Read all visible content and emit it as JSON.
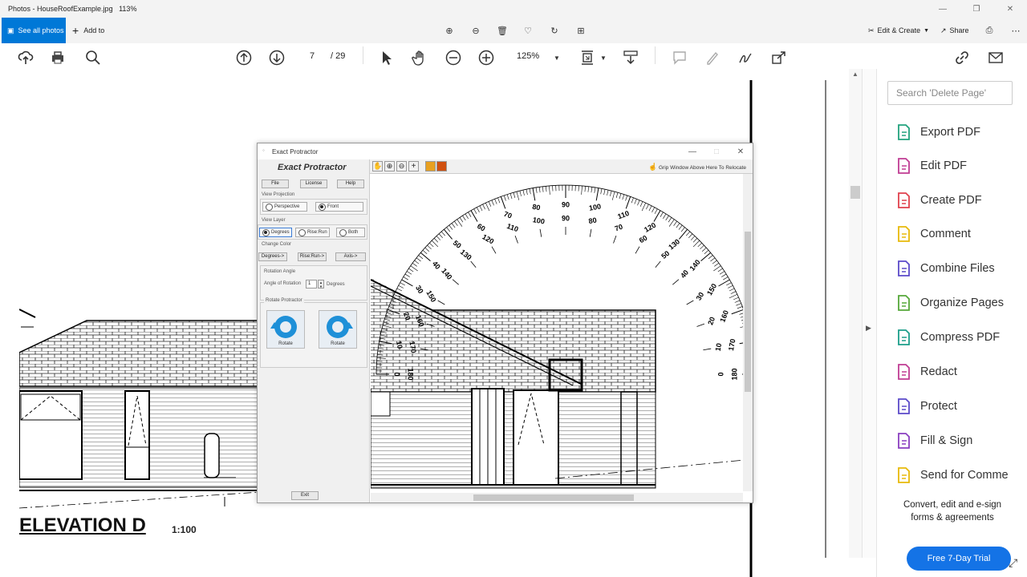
{
  "window": {
    "title": "Photos - HouseRoofExample.jpg",
    "zoom": "113%"
  },
  "photos_toolbar": {
    "see_all_label": "See all photos",
    "add_to_label": "Add to",
    "edit_create_label": "Edit & Create",
    "share_label": "Share"
  },
  "pdf_toolbar": {
    "page_current": "7",
    "page_total": "/  29",
    "zoom": "125%"
  },
  "tools_panel": {
    "search_placeholder": "Search 'Delete Page'",
    "items": [
      {
        "label": "Export PDF",
        "icon": "export-pdf-icon",
        "color": "#22a27d"
      },
      {
        "label": "Edit PDF",
        "icon": "edit-pdf-icon",
        "color": "#c03c93"
      },
      {
        "label": "Create PDF",
        "icon": "create-pdf-icon",
        "color": "#e0414d"
      },
      {
        "label": "Comment",
        "icon": "comment-icon",
        "color": "#e8b90a"
      },
      {
        "label": "Combine Files",
        "icon": "combine-files-icon",
        "color": "#5b4ac9"
      },
      {
        "label": "Organize Pages",
        "icon": "organize-pages-icon",
        "color": "#55a83a"
      },
      {
        "label": "Compress PDF",
        "icon": "compress-pdf-icon",
        "color": "#1c9e8a"
      },
      {
        "label": "Redact",
        "icon": "redact-icon",
        "color": "#c03c93"
      },
      {
        "label": "Protect",
        "icon": "protect-icon",
        "color": "#5b4ac9"
      },
      {
        "label": "Fill & Sign",
        "icon": "fill-sign-icon",
        "color": "#8a3fc0"
      },
      {
        "label": "Send for Comme",
        "icon": "send-comment-icon",
        "color": "#e8b90a"
      }
    ],
    "promo_line1": "Convert, edit and e-sign",
    "promo_line2": "forms & agreements",
    "trial_label": "Free 7-Day Trial"
  },
  "protractor_window": {
    "title": "Exact Protractor",
    "heading": "Exact Protractor",
    "menu": [
      "File",
      "License",
      "Help"
    ],
    "view_projection_label": "View Projection",
    "projection_options": [
      "Perspective",
      "Front"
    ],
    "projection_selected": "Front",
    "view_layer_label": "View Layer",
    "layer_options": [
      "Degrees",
      "Rise:Run",
      "Both"
    ],
    "layer_selected": "Degrees",
    "change_color_label": "Change Color",
    "color_buttons": [
      "Degrees->",
      "Rise:Run->",
      "Axis->"
    ],
    "rotation_angle_label": "Rotation Angle",
    "angle_field_label": "Angle of Rotation",
    "angle_value": "1",
    "angle_unit": "Degrees",
    "rotate_protractor_label": "Rotate Protractor",
    "rotate_left_label": "Rotate",
    "rotate_right_label": "Rotate",
    "exit_label": "Exit",
    "grip_text": "Grip Window Above Here To Relocate",
    "outer_scale": [
      "0",
      "10",
      "20",
      "30",
      "40",
      "50",
      "60",
      "70",
      "80",
      "90",
      "100",
      "110",
      "120",
      "130",
      "140",
      "150",
      "160",
      "170",
      "180"
    ],
    "inner_scale": [
      "180",
      "170",
      "160",
      "150",
      "140",
      "130",
      "120",
      "110",
      "100",
      "90",
      "80",
      "70",
      "60",
      "50",
      "40",
      "30",
      "20",
      "10",
      "0"
    ]
  },
  "drawing": {
    "elevation_title": "ELEVATION D",
    "elevation_scale": "1:100"
  }
}
